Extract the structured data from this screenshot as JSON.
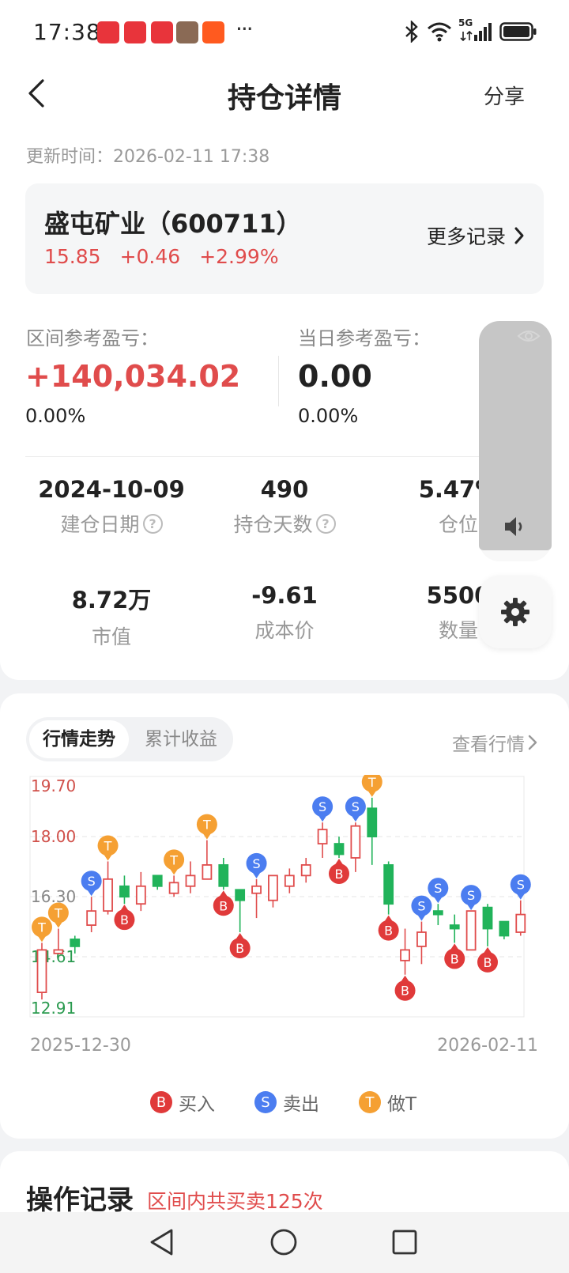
{
  "status_bar": {
    "time": "17:38",
    "more": "···",
    "icons": [
      "app-icon-1",
      "app-icon-2",
      "app-icon-3",
      "photo-icon",
      "taobao-icon",
      "bluetooth-icon",
      "wifi-icon",
      "signal-icon",
      "battery-icon"
    ],
    "network": "5G"
  },
  "header": {
    "title": "持仓详情",
    "share_label": "分享"
  },
  "update_time": "更新时间：2026-02-11 17:38",
  "stock": {
    "name": "盛屯矿业（600711）",
    "price": "15.85",
    "change": "+0.46",
    "change_pct": "+2.99%",
    "more_records": "更多记录"
  },
  "pnl": {
    "range_label": "区间参考盈亏：",
    "range_value": "+140,034.02",
    "range_pct": "0.00%",
    "today_label": "当日参考盈亏：",
    "today_value": "0.00",
    "today_pct": "0.00%"
  },
  "stats": [
    {
      "value": "2024-10-09",
      "label": "建仓日期"
    },
    {
      "value": "490",
      "label": "持仓天数"
    },
    {
      "value": "5.47%",
      "label": "仓位"
    },
    {
      "value": "8.72万",
      "label": "市值"
    },
    {
      "value": "-9.61",
      "label": "成本价"
    },
    {
      "value": "5500",
      "label": "数量"
    }
  ],
  "chart_tabs": {
    "active": "行情走势",
    "inactive": "累计收益",
    "view_market": "查看行情"
  },
  "chart_data": {
    "type": "candlestick",
    "y_ticks": [
      "19.70",
      "18.00",
      "16.30",
      "14.61",
      "12.91"
    ],
    "ylim": [
      12.91,
      19.7
    ],
    "x_start_label": "2025-12-30",
    "x_end_label": "2026-02-11",
    "candles": [
      {
        "o": 13.6,
        "c": 14.8,
        "h": 15.0,
        "l": 13.4
      },
      {
        "o": 14.7,
        "c": 14.8,
        "h": 15.4,
        "l": 14.7
      },
      {
        "o": 15.1,
        "c": 14.9,
        "h": 15.2,
        "l": 14.7
      },
      {
        "o": 15.5,
        "c": 15.9,
        "h": 16.3,
        "l": 15.3
      },
      {
        "o": 15.9,
        "c": 16.8,
        "h": 17.3,
        "l": 15.8
      },
      {
        "o": 16.6,
        "c": 16.3,
        "h": 16.9,
        "l": 16.1
      },
      {
        "o": 16.1,
        "c": 16.6,
        "h": 17.0,
        "l": 15.9
      },
      {
        "o": 16.9,
        "c": 16.6,
        "h": 16.9,
        "l": 16.5
      },
      {
        "o": 16.4,
        "c": 16.7,
        "h": 16.9,
        "l": 16.3
      },
      {
        "o": 16.6,
        "c": 16.9,
        "h": 17.3,
        "l": 16.4
      },
      {
        "o": 16.8,
        "c": 17.2,
        "h": 17.9,
        "l": 16.8
      },
      {
        "o": 17.2,
        "c": 16.6,
        "h": 17.4,
        "l": 16.5
      },
      {
        "o": 16.5,
        "c": 16.2,
        "h": 16.5,
        "l": 15.3
      },
      {
        "o": 16.4,
        "c": 16.6,
        "h": 16.8,
        "l": 15.7
      },
      {
        "o": 16.2,
        "c": 16.9,
        "h": 16.9,
        "l": 16.0
      },
      {
        "o": 16.6,
        "c": 16.9,
        "h": 17.1,
        "l": 16.4
      },
      {
        "o": 16.9,
        "c": 17.2,
        "h": 17.4,
        "l": 16.7
      },
      {
        "o": 17.8,
        "c": 18.2,
        "h": 18.4,
        "l": 17.4
      },
      {
        "o": 17.8,
        "c": 17.5,
        "h": 18.0,
        "l": 17.4
      },
      {
        "o": 17.4,
        "c": 18.3,
        "h": 18.4,
        "l": 17.0
      },
      {
        "o": 18.8,
        "c": 18.0,
        "h": 19.1,
        "l": 17.2
      },
      {
        "o": 17.2,
        "c": 16.1,
        "h": 17.3,
        "l": 15.8
      },
      {
        "o": 14.5,
        "c": 14.8,
        "h": 15.4,
        "l": 14.1
      },
      {
        "o": 14.9,
        "c": 15.3,
        "h": 15.6,
        "l": 14.4
      },
      {
        "o": 15.9,
        "c": 15.8,
        "h": 16.1,
        "l": 15.5
      },
      {
        "o": 15.5,
        "c": 15.4,
        "h": 15.8,
        "l": 15.0
      },
      {
        "o": 14.8,
        "c": 15.9,
        "h": 15.9,
        "l": 14.8
      },
      {
        "o": 16.0,
        "c": 15.4,
        "h": 16.1,
        "l": 14.9
      },
      {
        "o": 15.6,
        "c": 15.2,
        "h": 15.6,
        "l": 15.1
      },
      {
        "o": 15.3,
        "c": 15.8,
        "h": 16.2,
        "l": 15.2
      }
    ],
    "markers": [
      {
        "type": "T",
        "i": 0,
        "at": "high"
      },
      {
        "type": "T",
        "i": 1,
        "at": "high"
      },
      {
        "type": "S",
        "i": 3,
        "at": "high"
      },
      {
        "type": "T",
        "i": 4,
        "at": "high"
      },
      {
        "type": "B",
        "i": 5,
        "at": "low"
      },
      {
        "type": "T",
        "i": 8,
        "at": "high"
      },
      {
        "type": "T",
        "i": 10,
        "at": "high"
      },
      {
        "type": "B",
        "i": 11,
        "at": "low"
      },
      {
        "type": "B",
        "i": 12,
        "at": "low"
      },
      {
        "type": "S",
        "i": 13,
        "at": "high"
      },
      {
        "type": "S",
        "i": 17,
        "at": "high"
      },
      {
        "type": "B",
        "i": 18,
        "at": "low"
      },
      {
        "type": "S",
        "i": 19,
        "at": "high"
      },
      {
        "type": "T",
        "i": 20,
        "at": "high"
      },
      {
        "type": "B",
        "i": 21,
        "at": "low"
      },
      {
        "type": "B",
        "i": 22,
        "at": "low"
      },
      {
        "type": "S",
        "i": 23,
        "at": "high"
      },
      {
        "type": "S",
        "i": 24,
        "at": "high"
      },
      {
        "type": "B",
        "i": 25,
        "at": "low"
      },
      {
        "type": "S",
        "i": 26,
        "at": "high"
      },
      {
        "type": "B",
        "i": 27,
        "at": "low"
      },
      {
        "type": "S",
        "i": 29,
        "at": "high"
      }
    ]
  },
  "legend": [
    {
      "badge": "B",
      "label": "买入",
      "color": "#e03a3a"
    },
    {
      "badge": "S",
      "label": "卖出",
      "color": "#4b7df0"
    },
    {
      "badge": "T",
      "label": "做T",
      "color": "#f5a033"
    }
  ],
  "operations": {
    "title": "操作记录",
    "subtitle": "区间内共买卖125次"
  },
  "colors": {
    "up": "#e04c4c",
    "down": "#21b35a",
    "buy": "#e03a3a",
    "sell": "#4b7df0",
    "t": "#f5a033"
  }
}
